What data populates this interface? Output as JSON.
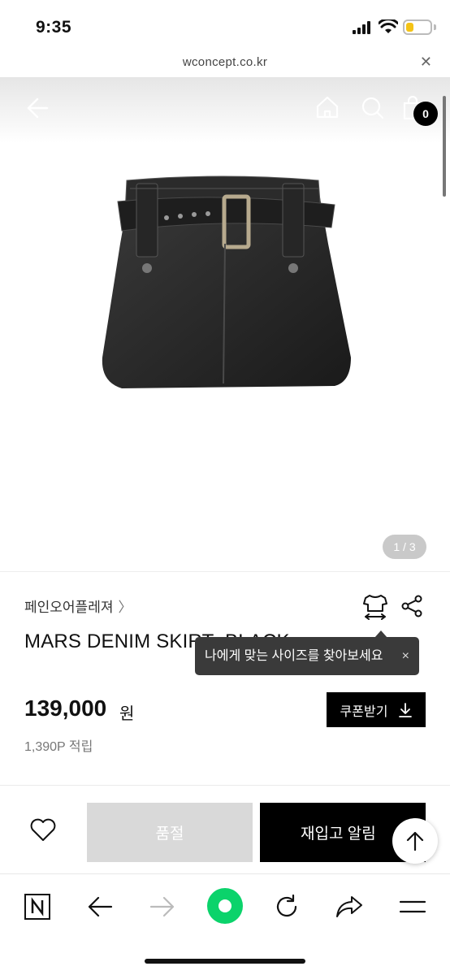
{
  "status_bar": {
    "time": "9:35"
  },
  "url_bar": {
    "url": "wconcept.co.kr",
    "close_icon": "close-icon"
  },
  "header": {
    "back_icon": "arrow-left-icon",
    "home_icon": "home-icon",
    "search_icon": "search-icon",
    "cart_icon": "shopping-bag-icon",
    "cart_count": "0"
  },
  "gallery": {
    "counter": "1 / 3",
    "product_image": "black denim mini skirt with belt"
  },
  "product": {
    "brand": "페인오어플레져",
    "title": "MARS DENIM SKIRT_BLACK",
    "fit_icon": "size-fit-icon",
    "share_icon": "share-icon",
    "tooltip": "나에게 맞는 사이즈를 찾아보세요",
    "tooltip_close": "×",
    "price": "139,000",
    "price_unit": "원",
    "points": "1,390P 적립",
    "coupon_label": "쿠폰받기"
  },
  "actions": {
    "wishlist_icon": "heart-icon",
    "soldout_label": "품절",
    "notify_label": "재입고 알림",
    "scroll_top_icon": "arrow-up-icon"
  },
  "toolbar": {
    "icons": [
      "naver-n-icon",
      "back-arrow-icon",
      "forward-arrow-icon",
      "naver-green-icon",
      "refresh-icon",
      "share-arrow-icon",
      "menu-icon"
    ]
  },
  "colors": {
    "accent_green": "#0bd36b",
    "battery": "#f4c316",
    "soldout": "#d9d9d9"
  }
}
